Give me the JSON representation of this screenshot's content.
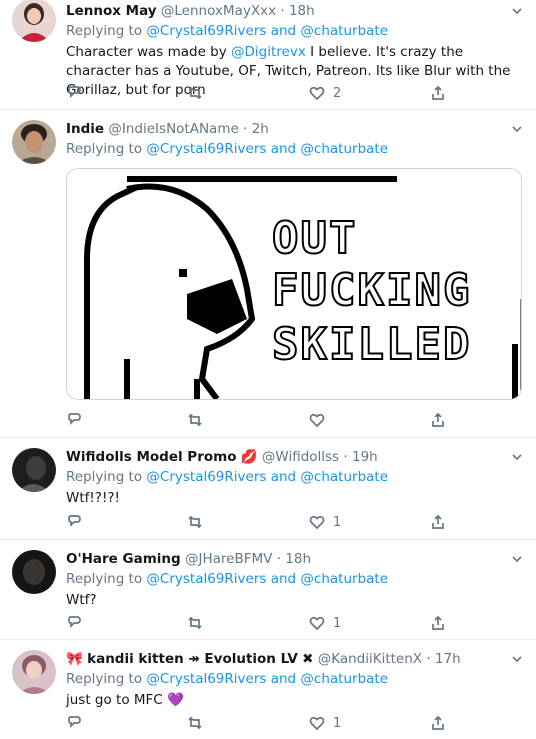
{
  "tweets": [
    {
      "name": "Lennox May",
      "handle": "@LennoxMayXxx",
      "sep": "·",
      "time": "18h",
      "replying_prefix": "Replying to",
      "reply_to_1": "@Crystal69Rivers",
      "and": "and",
      "reply_to_2": "@chaturbate",
      "text_pre": "Character was made by",
      "text_mention": "@Digitrevx",
      "text_post": "I believe. It's crazy the character has a Youtube, OF, Twitch, Patreon. Its like Blur with the Gorillaz, but for porn",
      "likes": "2",
      "retweets": "",
      "replies": ""
    },
    {
      "name": "Indie",
      "handle": "@IndieIsNotAName",
      "sep": "·",
      "time": "2h",
      "replying_prefix": "Replying to",
      "reply_to_1": "@Crystal69Rivers",
      "and": "and",
      "reply_to_2": "@chaturbate",
      "meme_lines": [
        "OUT",
        "FUCKING",
        "SKILLED"
      ],
      "likes": "",
      "retweets": "",
      "replies": ""
    },
    {
      "name": "Wifidolls Model Promo",
      "name_emoji": "💋",
      "handle": "@Wifidollss",
      "sep": "·",
      "time": "19h",
      "replying_prefix": "Replying to",
      "reply_to_1": "@Crystal69Rivers",
      "and": "and",
      "reply_to_2": "@chaturbate",
      "text": "Wtf!?!?!",
      "likes": "1"
    },
    {
      "name": "O'Hare Gaming",
      "handle": "@JHareBFMV",
      "sep": "·",
      "time": "18h",
      "replying_prefix": "Replying to",
      "reply_to_1": "@Crystal69Rivers",
      "and": "and",
      "reply_to_2": "@chaturbate",
      "text": "Wtf?",
      "likes": "1"
    },
    {
      "name_prefix_emoji": "🎀",
      "name": "kandii kitten ↠ Evolution LV",
      "name_suffix_emoji": "✖",
      "handle": "@KandiiKittenX",
      "sep": "·",
      "time": "17h",
      "replying_prefix": "Replying to",
      "reply_to_1": "@Crystal69Rivers",
      "and": "and",
      "reply_to_2": "@chaturbate",
      "text": "just go to MFC",
      "text_emoji": "💜",
      "likes": "1"
    }
  ],
  "icons": {
    "reply": "reply-icon",
    "retweet": "retweet-icon",
    "like": "heart-icon",
    "share": "share-icon",
    "caret": "chevron-down-icon"
  },
  "colors": {
    "link": "#1b95e0",
    "secondary": "#657786",
    "border": "#e6ecf0"
  }
}
